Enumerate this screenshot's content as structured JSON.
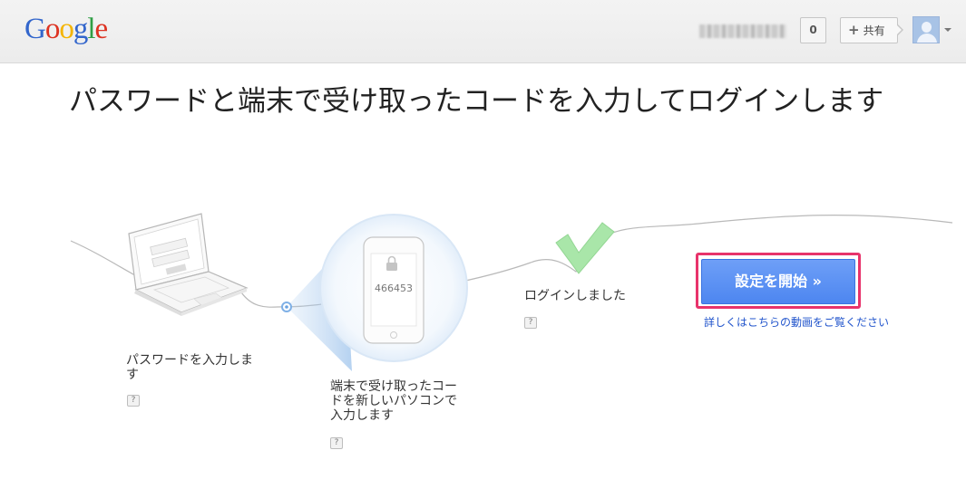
{
  "header": {
    "logo_letters": [
      "G",
      "o",
      "o",
      "g",
      "l",
      "e"
    ],
    "notification_count": "0",
    "share_label": "共有"
  },
  "headline": "パスワードと端末で受け取ったコードを入力してログインします",
  "illustration": {
    "phone_code": "466453"
  },
  "steps": [
    {
      "text": "パスワードを入力します",
      "help": "?"
    },
    {
      "text": "端末で受け取ったコードを新しいパソコンで入力します",
      "help": "?"
    },
    {
      "text": "ログインしました",
      "help": "?"
    }
  ],
  "setup_button_label": "設定を開始 »",
  "video_link": "詳しくはこちらの動画をご覧ください",
  "colors": {
    "button_blue": "#5b92f3",
    "highlight_frame": "#e8336b",
    "check_green": "#a9e6a9",
    "link_blue": "#2255cc"
  }
}
